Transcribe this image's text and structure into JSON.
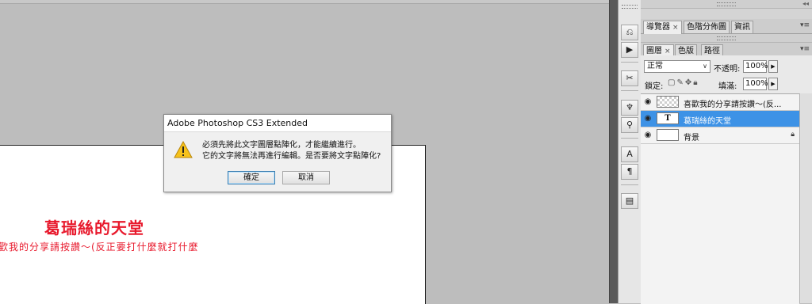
{
  "canvas": {
    "title": "葛瑞絲的天堂",
    "subtitle": "歡我的分享請按讚～(反正要打什麼就打什麼"
  },
  "dialog": {
    "title": "Adobe Photoshop CS3 Extended",
    "message_line1": "必須先將此文字圖層點陣化，才能繼續進行。",
    "message_line2": "它的文字將無法再進行編輯。是否要將文字點陣化?",
    "ok_label": "確定",
    "cancel_label": "取消",
    "icon": "warning-icon"
  },
  "icon_strip": {
    "buttons": [
      "history-icon",
      "actions-icon",
      "tools-icon",
      "brush-icon",
      "stamp-icon",
      "character-icon",
      "paragraph-icon",
      "layer-comps-icon"
    ]
  },
  "top_panel": {
    "tabs": [
      "導覽器",
      "色階分佈圖",
      "資訊"
    ],
    "close_glyph": "×"
  },
  "layers_panel": {
    "tabs": [
      "圖層",
      "色版",
      "路徑"
    ],
    "blend_mode": "正常",
    "opacity_label": "不透明:",
    "opacity_value": "100%",
    "lock_label": "鎖定:",
    "fill_label": "填滿:",
    "fill_value": "100%",
    "layers": [
      {
        "name": "喜歡我的分享請按讚～(反...",
        "thumb": "transparent",
        "selected": false
      },
      {
        "name": "葛瑞絲的天堂",
        "thumb": "T",
        "selected": true
      },
      {
        "name": "背景",
        "thumb": "white",
        "selected": false,
        "locked": true
      }
    ]
  },
  "colors": {
    "accent": "#3d92e6",
    "canvas_text": "#e8192c",
    "workspace": "#bdbdbd"
  }
}
